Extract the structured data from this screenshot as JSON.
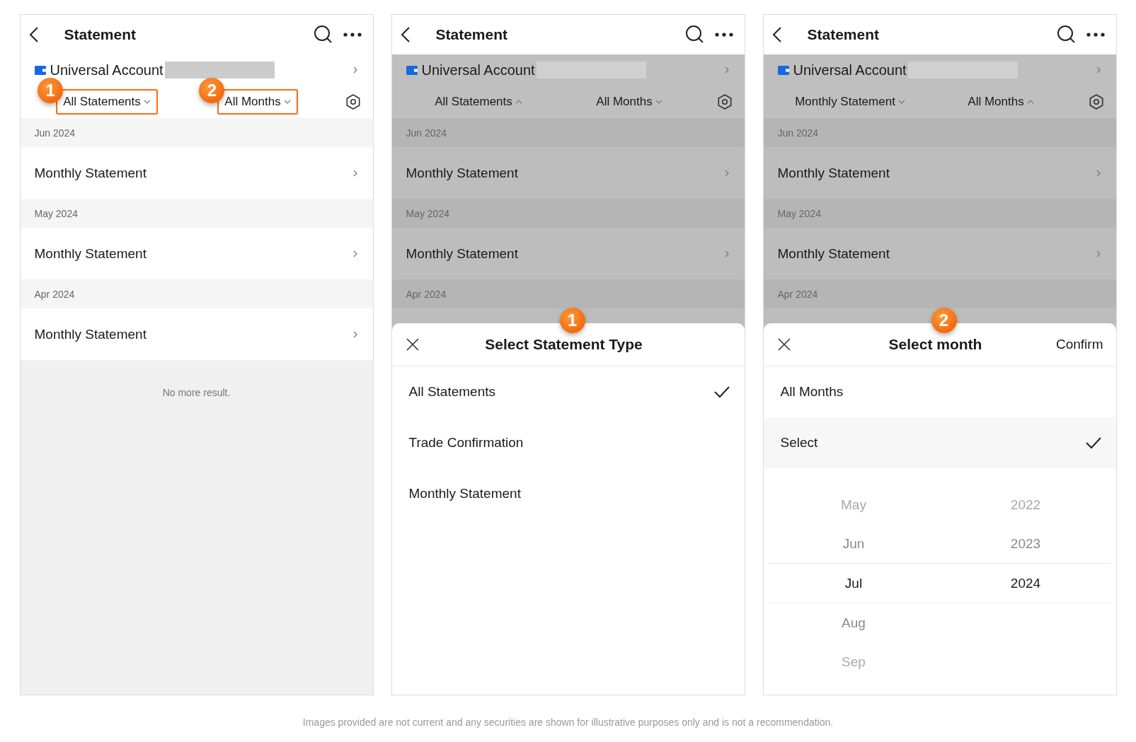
{
  "screens": [
    {
      "title": "Statement",
      "dimmed": false,
      "account": "Universal Account",
      "filters": [
        {
          "label": "All Statements",
          "expanded": false,
          "highlighted": true,
          "badge": "1"
        },
        {
          "label": "All Months",
          "expanded": false,
          "highlighted": true,
          "badge": "2"
        }
      ],
      "sections": [
        {
          "date": "Jun 2024",
          "items": [
            "Monthly Statement"
          ]
        },
        {
          "date": "May 2024",
          "items": [
            "Monthly Statement"
          ]
        },
        {
          "date": "Apr 2024",
          "items": [
            "Monthly Statement"
          ]
        }
      ],
      "end_note": "No more result."
    },
    {
      "title": "Statement",
      "dimmed": true,
      "account": "Universal Account",
      "filters": [
        {
          "label": "All Statements",
          "expanded": true,
          "highlighted": false
        },
        {
          "label": "All Months",
          "expanded": false,
          "highlighted": false
        }
      ],
      "sections": [
        {
          "date": "Jun 2024",
          "items": [
            "Monthly Statement"
          ]
        },
        {
          "date": "May 2024",
          "items": [
            "Monthly Statement"
          ]
        },
        {
          "date": "Apr 2024"
        }
      ],
      "sheet": {
        "kind": "list",
        "badge": "1",
        "title": "Select Statement Type",
        "options": [
          {
            "label": "All Statements",
            "selected": true
          },
          {
            "label": "Trade Confirmation",
            "selected": false
          },
          {
            "label": "Monthly Statement",
            "selected": false
          }
        ]
      }
    },
    {
      "title": "Statement",
      "dimmed": true,
      "account": "Universal Account",
      "filters": [
        {
          "label": "Monthly Statement",
          "expanded": false,
          "highlighted": false
        },
        {
          "label": "All Months",
          "expanded": true,
          "highlighted": false
        }
      ],
      "sections": [
        {
          "date": "Jun 2024",
          "items": [
            "Monthly Statement"
          ]
        },
        {
          "date": "May 2024",
          "items": [
            "Monthly Statement"
          ]
        },
        {
          "date": "Apr 2024"
        }
      ],
      "sheet": {
        "kind": "month",
        "badge": "2",
        "title": "Select month",
        "confirm": "Confirm",
        "options": [
          {
            "label": "All Months",
            "selected": false
          },
          {
            "label": "Select",
            "selected": true
          }
        ],
        "picker": {
          "months": [
            {
              "label": "May",
              "selected": false
            },
            {
              "label": "Jun",
              "selected": false
            },
            {
              "label": "Jul",
              "selected": true
            },
            {
              "label": "Aug",
              "selected": false
            },
            {
              "label": "Sep",
              "selected": false
            }
          ],
          "years": [
            {
              "label": "2022",
              "selected": false
            },
            {
              "label": "2023",
              "selected": false
            },
            {
              "label": "2024",
              "selected": true
            }
          ]
        }
      }
    }
  ],
  "disclaimer": "Images provided are not current and any securities are shown for illustrative purposes only and is not a recommendation."
}
